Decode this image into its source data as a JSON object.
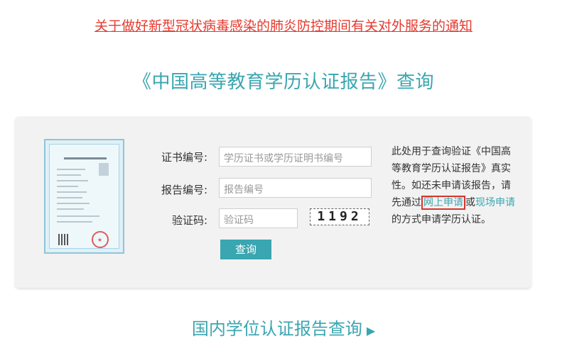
{
  "notice": {
    "text": "关于做好新型冠状病毒感染的肺炎防控期间有关对外服务的通知"
  },
  "title": "《中国高等教育学历认证报告》查询",
  "form": {
    "cert_label": "证书编号:",
    "cert_placeholder": "学历证书或学历证明书编号",
    "report_label": "报告编号:",
    "report_placeholder": "报告编号",
    "captcha_label": "验证码:",
    "captcha_placeholder": "验证码",
    "captcha_text": "1192",
    "submit_label": "查询"
  },
  "description": {
    "text_before": "此处用于查询验证《中国高等教育学历认证报告》真实性。如还未申请该报告，请先通过",
    "link_online": "网上申请",
    "text_or": "或",
    "link_onsite": "现场申请",
    "text_after": "的方式申请学历认证。"
  },
  "degree_link": {
    "text": "国内学位认证报告查询",
    "arrow": "▶"
  },
  "colors": {
    "accent": "#3aa6b0",
    "notice": "#e53a2f",
    "highlight_box": "#d9332b"
  },
  "icons": {
    "report_image": "certificate-report-image",
    "arrow": "triangle-right-icon"
  }
}
